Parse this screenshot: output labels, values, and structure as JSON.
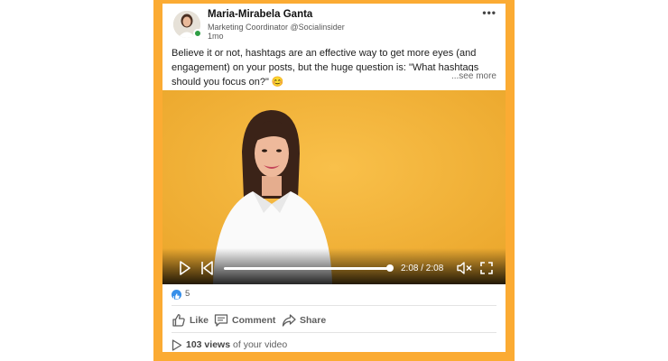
{
  "post": {
    "author_name": "Maria-Mirabela Ganta",
    "author_headline": "Marketing Coordinator @Socialinsider",
    "timestamp": "1mo",
    "more_label": "•••",
    "text": "Believe it or not, hashtags are an effective way to get more eyes (and engagement) on your posts, but the huge question is: \"What hashtags should you focus on?\" 😊",
    "see_more_label": "...see more"
  },
  "video": {
    "time_display": "2:08 / 2:08",
    "progress": 1.0,
    "background_color": "#f5b83a",
    "controls": [
      "play-icon",
      "previous-icon",
      "mute-icon",
      "fullscreen-icon"
    ]
  },
  "social": {
    "reaction_count": "5",
    "reaction_icon": "like-icon",
    "reaction_color": "#378fe9"
  },
  "actions": {
    "like_label": "Like",
    "comment_label": "Comment",
    "share_label": "Share"
  },
  "analytics": {
    "views_count": "103 views",
    "views_suffix": "of your video"
  },
  "colors": {
    "frame": "#fbab33",
    "online": "#2f9e44"
  }
}
